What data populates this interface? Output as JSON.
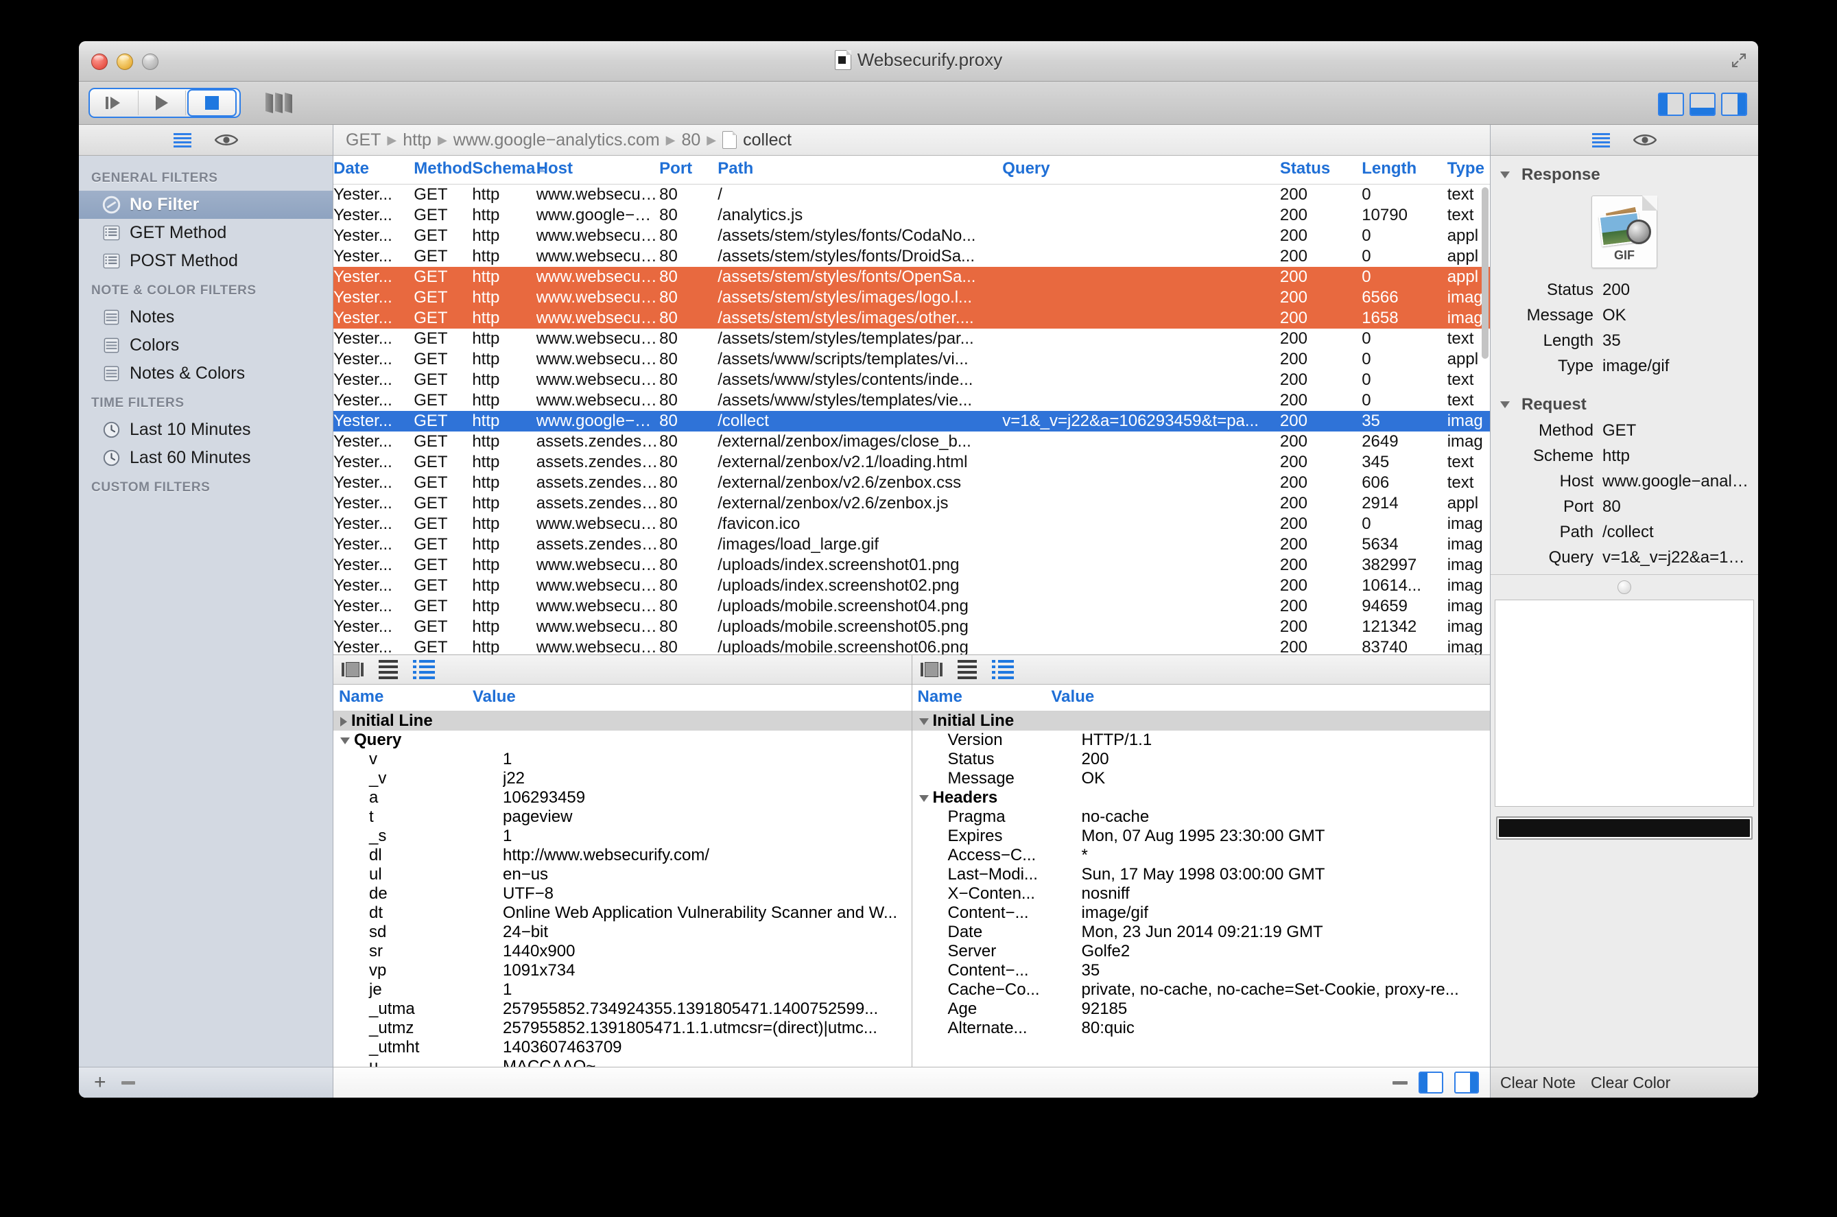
{
  "window": {
    "title": "Websecurify.proxy"
  },
  "toolbar": {
    "step_label": "step",
    "play_label": "play",
    "stop_label": "stop",
    "bars_label": "columns",
    "toggle_left": "Toggle Left Panel",
    "toggle_bottom": "Toggle Bottom Panel",
    "toggle_right": "Toggle Right Panel"
  },
  "sidebar": {
    "groups": [
      {
        "title": "GENERAL FILTERS",
        "items": [
          {
            "label": "No Filter",
            "icon": "no-filter-icon",
            "active": true
          },
          {
            "label": "GET Method",
            "icon": "list-icon",
            "active": false
          },
          {
            "label": "POST Method",
            "icon": "list-icon",
            "active": false
          }
        ]
      },
      {
        "title": "NOTE & COLOR FILTERS",
        "items": [
          {
            "label": "Notes",
            "icon": "notepad-icon",
            "active": false
          },
          {
            "label": "Colors",
            "icon": "notepad-icon",
            "active": false
          },
          {
            "label": "Notes & Colors",
            "icon": "notepad-icon",
            "active": false
          }
        ]
      },
      {
        "title": "TIME FILTERS",
        "items": [
          {
            "label": "Last 10 Minutes",
            "icon": "clock-icon",
            "active": false
          },
          {
            "label": "Last 60 Minutes",
            "icon": "clock-icon",
            "active": false
          }
        ]
      },
      {
        "title": "CUSTOM FILTERS",
        "items": []
      }
    ],
    "footer": {
      "add_label": "+",
      "remove_label": "−"
    }
  },
  "breadcrumb": {
    "parts": [
      "GET",
      "http",
      "www.google−analytics.com",
      "80"
    ],
    "leaf": "collect"
  },
  "table": {
    "columns": [
      "Date",
      "Method",
      "Schema",
      "Host",
      "Port",
      "Path",
      "Query",
      "Status",
      "Length",
      "Type"
    ],
    "sorted_column": "Schema",
    "sort_direction": "asc",
    "rows": [
      {
        "date": "Yester...",
        "method": "GET",
        "schema": "http",
        "host": "www.websecuri...",
        "port": "80",
        "path": "/",
        "query": "",
        "status": "200",
        "length": "0",
        "type": "text",
        "state": ""
      },
      {
        "date": "Yester...",
        "method": "GET",
        "schema": "http",
        "host": "www.google−an...",
        "port": "80",
        "path": "/analytics.js",
        "query": "",
        "status": "200",
        "length": "10790",
        "type": "text",
        "state": ""
      },
      {
        "date": "Yester...",
        "method": "GET",
        "schema": "http",
        "host": "www.websecuri...",
        "port": "80",
        "path": "/assets/stem/styles/fonts/CodaNo...",
        "query": "",
        "status": "200",
        "length": "0",
        "type": "appl",
        "state": ""
      },
      {
        "date": "Yester...",
        "method": "GET",
        "schema": "http",
        "host": "www.websecuri...",
        "port": "80",
        "path": "/assets/stem/styles/fonts/DroidSa...",
        "query": "",
        "status": "200",
        "length": "0",
        "type": "appl",
        "state": ""
      },
      {
        "date": "Yester...",
        "method": "GET",
        "schema": "http",
        "host": "www.websecuri...",
        "port": "80",
        "path": "/assets/stem/styles/fonts/OpenSa...",
        "query": "",
        "status": "200",
        "length": "0",
        "type": "appl",
        "state": "orange"
      },
      {
        "date": "Yester...",
        "method": "GET",
        "schema": "http",
        "host": "www.websecuri...",
        "port": "80",
        "path": "/assets/stem/styles/images/logo.l...",
        "query": "",
        "status": "200",
        "length": "6566",
        "type": "imag",
        "state": "orange"
      },
      {
        "date": "Yester...",
        "method": "GET",
        "schema": "http",
        "host": "www.websecuri...",
        "port": "80",
        "path": "/assets/stem/styles/images/other....",
        "query": "",
        "status": "200",
        "length": "1658",
        "type": "imag",
        "state": "orange"
      },
      {
        "date": "Yester...",
        "method": "GET",
        "schema": "http",
        "host": "www.websecuri...",
        "port": "80",
        "path": "/assets/stem/styles/templates/par...",
        "query": "",
        "status": "200",
        "length": "0",
        "type": "text",
        "state": ""
      },
      {
        "date": "Yester...",
        "method": "GET",
        "schema": "http",
        "host": "www.websecuri...",
        "port": "80",
        "path": "/assets/www/scripts/templates/vi...",
        "query": "",
        "status": "200",
        "length": "0",
        "type": "appl",
        "state": ""
      },
      {
        "date": "Yester...",
        "method": "GET",
        "schema": "http",
        "host": "www.websecuri...",
        "port": "80",
        "path": "/assets/www/styles/contents/inde...",
        "query": "",
        "status": "200",
        "length": "0",
        "type": "text",
        "state": ""
      },
      {
        "date": "Yester...",
        "method": "GET",
        "schema": "http",
        "host": "www.websecuri...",
        "port": "80",
        "path": "/assets/www/styles/templates/vie...",
        "query": "",
        "status": "200",
        "length": "0",
        "type": "text",
        "state": ""
      },
      {
        "date": "Yester...",
        "method": "GET",
        "schema": "http",
        "host": "www.google−an...",
        "port": "80",
        "path": "/collect",
        "query": "v=1&_v=j22&a=106293459&t=pa...",
        "status": "200",
        "length": "35",
        "type": "imag",
        "state": "selected"
      },
      {
        "date": "Yester...",
        "method": "GET",
        "schema": "http",
        "host": "assets.zendesk....",
        "port": "80",
        "path": "/external/zenbox/images/close_b...",
        "query": "",
        "status": "200",
        "length": "2649",
        "type": "imag",
        "state": ""
      },
      {
        "date": "Yester...",
        "method": "GET",
        "schema": "http",
        "host": "assets.zendesk....",
        "port": "80",
        "path": "/external/zenbox/v2.1/loading.html",
        "query": "",
        "status": "200",
        "length": "345",
        "type": "text",
        "state": ""
      },
      {
        "date": "Yester...",
        "method": "GET",
        "schema": "http",
        "host": "assets.zendesk....",
        "port": "80",
        "path": "/external/zenbox/v2.6/zenbox.css",
        "query": "",
        "status": "200",
        "length": "606",
        "type": "text",
        "state": ""
      },
      {
        "date": "Yester...",
        "method": "GET",
        "schema": "http",
        "host": "assets.zendesk....",
        "port": "80",
        "path": "/external/zenbox/v2.6/zenbox.js",
        "query": "",
        "status": "200",
        "length": "2914",
        "type": "appl",
        "state": ""
      },
      {
        "date": "Yester...",
        "method": "GET",
        "schema": "http",
        "host": "www.websecuri...",
        "port": "80",
        "path": "/favicon.ico",
        "query": "",
        "status": "200",
        "length": "0",
        "type": "imag",
        "state": ""
      },
      {
        "date": "Yester...",
        "method": "GET",
        "schema": "http",
        "host": "assets.zendesk....",
        "port": "80",
        "path": "/images/load_large.gif",
        "query": "",
        "status": "200",
        "length": "5634",
        "type": "imag",
        "state": ""
      },
      {
        "date": "Yester...",
        "method": "GET",
        "schema": "http",
        "host": "www.websecuri...",
        "port": "80",
        "path": "/uploads/index.screenshot01.png",
        "query": "",
        "status": "200",
        "length": "382997",
        "type": "imag",
        "state": ""
      },
      {
        "date": "Yester...",
        "method": "GET",
        "schema": "http",
        "host": "www.websecuri...",
        "port": "80",
        "path": "/uploads/index.screenshot02.png",
        "query": "",
        "status": "200",
        "length": "10614...",
        "type": "imag",
        "state": ""
      },
      {
        "date": "Yester...",
        "method": "GET",
        "schema": "http",
        "host": "www.websecuri...",
        "port": "80",
        "path": "/uploads/mobile.screenshot04.png",
        "query": "",
        "status": "200",
        "length": "94659",
        "type": "imag",
        "state": ""
      },
      {
        "date": "Yester...",
        "method": "GET",
        "schema": "http",
        "host": "www.websecuri...",
        "port": "80",
        "path": "/uploads/mobile.screenshot05.png",
        "query": "",
        "status": "200",
        "length": "121342",
        "type": "imag",
        "state": ""
      },
      {
        "date": "Yester...",
        "method": "GET",
        "schema": "http",
        "host": "www.websecuri...",
        "port": "80",
        "path": "/uploads/mobile.screenshot06.png",
        "query": "",
        "status": "200",
        "length": "83740",
        "type": "imag",
        "state": ""
      }
    ]
  },
  "request_detail": {
    "columns": {
      "name": "Name",
      "value": "Value"
    },
    "rows": [
      {
        "name": "Initial Line",
        "value": "",
        "level": 0,
        "twisty": "closed",
        "group": true
      },
      {
        "name": "Query",
        "value": "",
        "level": 0,
        "twisty": "open",
        "group": false
      },
      {
        "name": "v",
        "value": "1",
        "level": 1,
        "twisty": "",
        "group": false
      },
      {
        "name": "_v",
        "value": "j22",
        "level": 1,
        "twisty": "",
        "group": false
      },
      {
        "name": "a",
        "value": "106293459",
        "level": 1,
        "twisty": "",
        "group": false
      },
      {
        "name": "t",
        "value": "pageview",
        "level": 1,
        "twisty": "",
        "group": false
      },
      {
        "name": "_s",
        "value": "1",
        "level": 1,
        "twisty": "",
        "group": false
      },
      {
        "name": "dl",
        "value": "http://www.websecurify.com/",
        "level": 1,
        "twisty": "",
        "group": false
      },
      {
        "name": "ul",
        "value": "en−us",
        "level": 1,
        "twisty": "",
        "group": false
      },
      {
        "name": "de",
        "value": "UTF−8",
        "level": 1,
        "twisty": "",
        "group": false
      },
      {
        "name": "dt",
        "value": "Online Web Application Vulnerability Scanner and W...",
        "level": 1,
        "twisty": "",
        "group": false
      },
      {
        "name": "sd",
        "value": "24−bit",
        "level": 1,
        "twisty": "",
        "group": false
      },
      {
        "name": "sr",
        "value": "1440x900",
        "level": 1,
        "twisty": "",
        "group": false
      },
      {
        "name": "vp",
        "value": "1091x734",
        "level": 1,
        "twisty": "",
        "group": false
      },
      {
        "name": "je",
        "value": "1",
        "level": 1,
        "twisty": "",
        "group": false
      },
      {
        "name": "_utma",
        "value": "257955852.734924355.1391805471.1400752599...",
        "level": 1,
        "twisty": "",
        "group": false
      },
      {
        "name": "_utmz",
        "value": "257955852.1391805471.1.1.utmcsr=(direct)|utmc...",
        "level": 1,
        "twisty": "",
        "group": false
      },
      {
        "name": "_utmht",
        "value": "1403607463709",
        "level": 1,
        "twisty": "",
        "group": false
      },
      {
        "name": "u",
        "value": "MACCAAQ~",
        "level": 1,
        "twisty": "",
        "group": false
      }
    ]
  },
  "response_detail": {
    "columns": {
      "name": "Name",
      "value": "Value"
    },
    "rows": [
      {
        "name": "Initial Line",
        "value": "",
        "level": 0,
        "twisty": "open",
        "group": true
      },
      {
        "name": "Version",
        "value": "HTTP/1.1",
        "level": 1,
        "twisty": "",
        "group": false
      },
      {
        "name": "Status",
        "value": "200",
        "level": 1,
        "twisty": "",
        "group": false
      },
      {
        "name": "Message",
        "value": "OK",
        "level": 1,
        "twisty": "",
        "group": false
      },
      {
        "name": "Headers",
        "value": "",
        "level": 0,
        "twisty": "open",
        "group": false
      },
      {
        "name": "Pragma",
        "value": "no-cache",
        "level": 1,
        "twisty": "",
        "group": false
      },
      {
        "name": "Expires",
        "value": "Mon, 07 Aug 1995 23:30:00 GMT",
        "level": 1,
        "twisty": "",
        "group": false
      },
      {
        "name": "Access−C...",
        "value": "*",
        "level": 1,
        "twisty": "",
        "group": false
      },
      {
        "name": "Last−Modi...",
        "value": "Sun, 17 May 1998 03:00:00 GMT",
        "level": 1,
        "twisty": "",
        "group": false
      },
      {
        "name": "X−Conten...",
        "value": "nosniff",
        "level": 1,
        "twisty": "",
        "group": false
      },
      {
        "name": "Content−...",
        "value": "image/gif",
        "level": 1,
        "twisty": "",
        "group": false
      },
      {
        "name": "Date",
        "value": "Mon, 23 Jun 2014 09:21:19 GMT",
        "level": 1,
        "twisty": "",
        "group": false
      },
      {
        "name": "Server",
        "value": "Golfe2",
        "level": 1,
        "twisty": "",
        "group": false
      },
      {
        "name": "Content−...",
        "value": "35",
        "level": 1,
        "twisty": "",
        "group": false
      },
      {
        "name": "Cache−Co...",
        "value": "private, no-cache, no-cache=Set-Cookie, proxy-re...",
        "level": 1,
        "twisty": "",
        "group": false
      },
      {
        "name": "Age",
        "value": "92185",
        "level": 1,
        "twisty": "",
        "group": false
      },
      {
        "name": "Alternate...",
        "value": "80:quic",
        "level": 1,
        "twisty": "",
        "group": false
      }
    ]
  },
  "inspector": {
    "response": {
      "title": "Response",
      "preview_label": "GIF",
      "fields": [
        {
          "key": "Status",
          "value": "200"
        },
        {
          "key": "Message",
          "value": "OK"
        },
        {
          "key": "Length",
          "value": "35"
        },
        {
          "key": "Type",
          "value": "image/gif"
        }
      ]
    },
    "request": {
      "title": "Request",
      "fields": [
        {
          "key": "Method",
          "value": "GET"
        },
        {
          "key": "Scheme",
          "value": "http"
        },
        {
          "key": "Host",
          "value": "www.google−analytics..."
        },
        {
          "key": "Port",
          "value": "80"
        },
        {
          "key": "Path",
          "value": "/collect"
        },
        {
          "key": "Query",
          "value": "v=1&_v=j22&a=1062..."
        }
      ]
    },
    "footer": {
      "clear_note": "Clear Note",
      "clear_color": "Clear Color"
    }
  },
  "colors": {
    "accent_blue": "#2f7fe8",
    "row_selected": "#2f73d8",
    "row_marked": "#e8693f",
    "header_text": "#1f6fd6",
    "sidebar_bg": "#d3d9e2"
  }
}
